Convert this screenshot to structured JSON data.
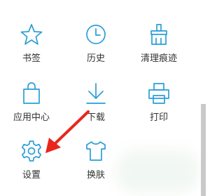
{
  "accent_color": "#2a9fd6",
  "annotation_color": "#e8261e",
  "menu": {
    "items": [
      {
        "label": "书签",
        "icon": "star-icon"
      },
      {
        "label": "历史",
        "icon": "clock-icon"
      },
      {
        "label": "清理痕迹",
        "icon": "broom-icon"
      },
      {
        "label": "应用中心",
        "icon": "bag-icon"
      },
      {
        "label": "下载",
        "icon": "download-icon"
      },
      {
        "label": "打印",
        "icon": "printer-icon"
      },
      {
        "label": "设置",
        "icon": "gear-icon"
      },
      {
        "label": "换肤",
        "icon": "shirt-icon"
      }
    ]
  }
}
